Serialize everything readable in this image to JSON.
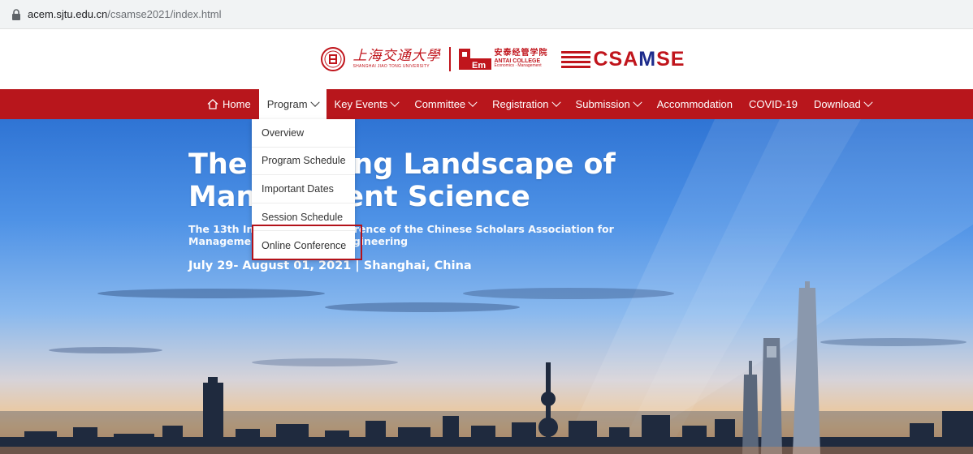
{
  "browser": {
    "url_host": "acem.sjtu.edu.cn",
    "url_path": "/csamse2021/index.html"
  },
  "logos": {
    "sjtu_cn": "上海交通大學",
    "sjtu_en": "SHANGHAI JIAO TONG UNIVERSITY",
    "acem_cn": "安泰经管学院",
    "acem_en1": "ANTAI COLLEGE",
    "acem_en2": "Economics · Management",
    "csamse_red": "CSA",
    "csamse_blue": "M",
    "csamse_red2": "SE"
  },
  "nav": {
    "items": [
      {
        "label": "Home",
        "icon": "home-icon",
        "dropdown": false
      },
      {
        "label": "Program",
        "dropdown": true,
        "active": true
      },
      {
        "label": "Key Events",
        "dropdown": true
      },
      {
        "label": "Committee",
        "dropdown": true
      },
      {
        "label": "Registration",
        "dropdown": true
      },
      {
        "label": "Submission",
        "dropdown": true
      },
      {
        "label": "Accommodation",
        "dropdown": false
      },
      {
        "label": "COVID-19",
        "dropdown": false
      },
      {
        "label": "Download",
        "dropdown": true
      }
    ]
  },
  "dropdown": {
    "items": [
      "Overview",
      "Program Schedule",
      "Important Dates",
      "Session Schedule",
      "Online Conference"
    ],
    "highlighted": "Online Conference"
  },
  "hero": {
    "title_line1": "The Evolving Landscape of",
    "title_line2": "Management Science",
    "subtitle_line1": "The 13th International Conference of the Chinese Scholars Association for",
    "subtitle_line2": "Management Science and Engineering",
    "date": "July 29- August 01, 2021 | Shanghai, China"
  },
  "colors": {
    "nav_red": "#b8161c",
    "brand_blue": "#1e2c8c",
    "highlight_border": "#b3121a"
  }
}
